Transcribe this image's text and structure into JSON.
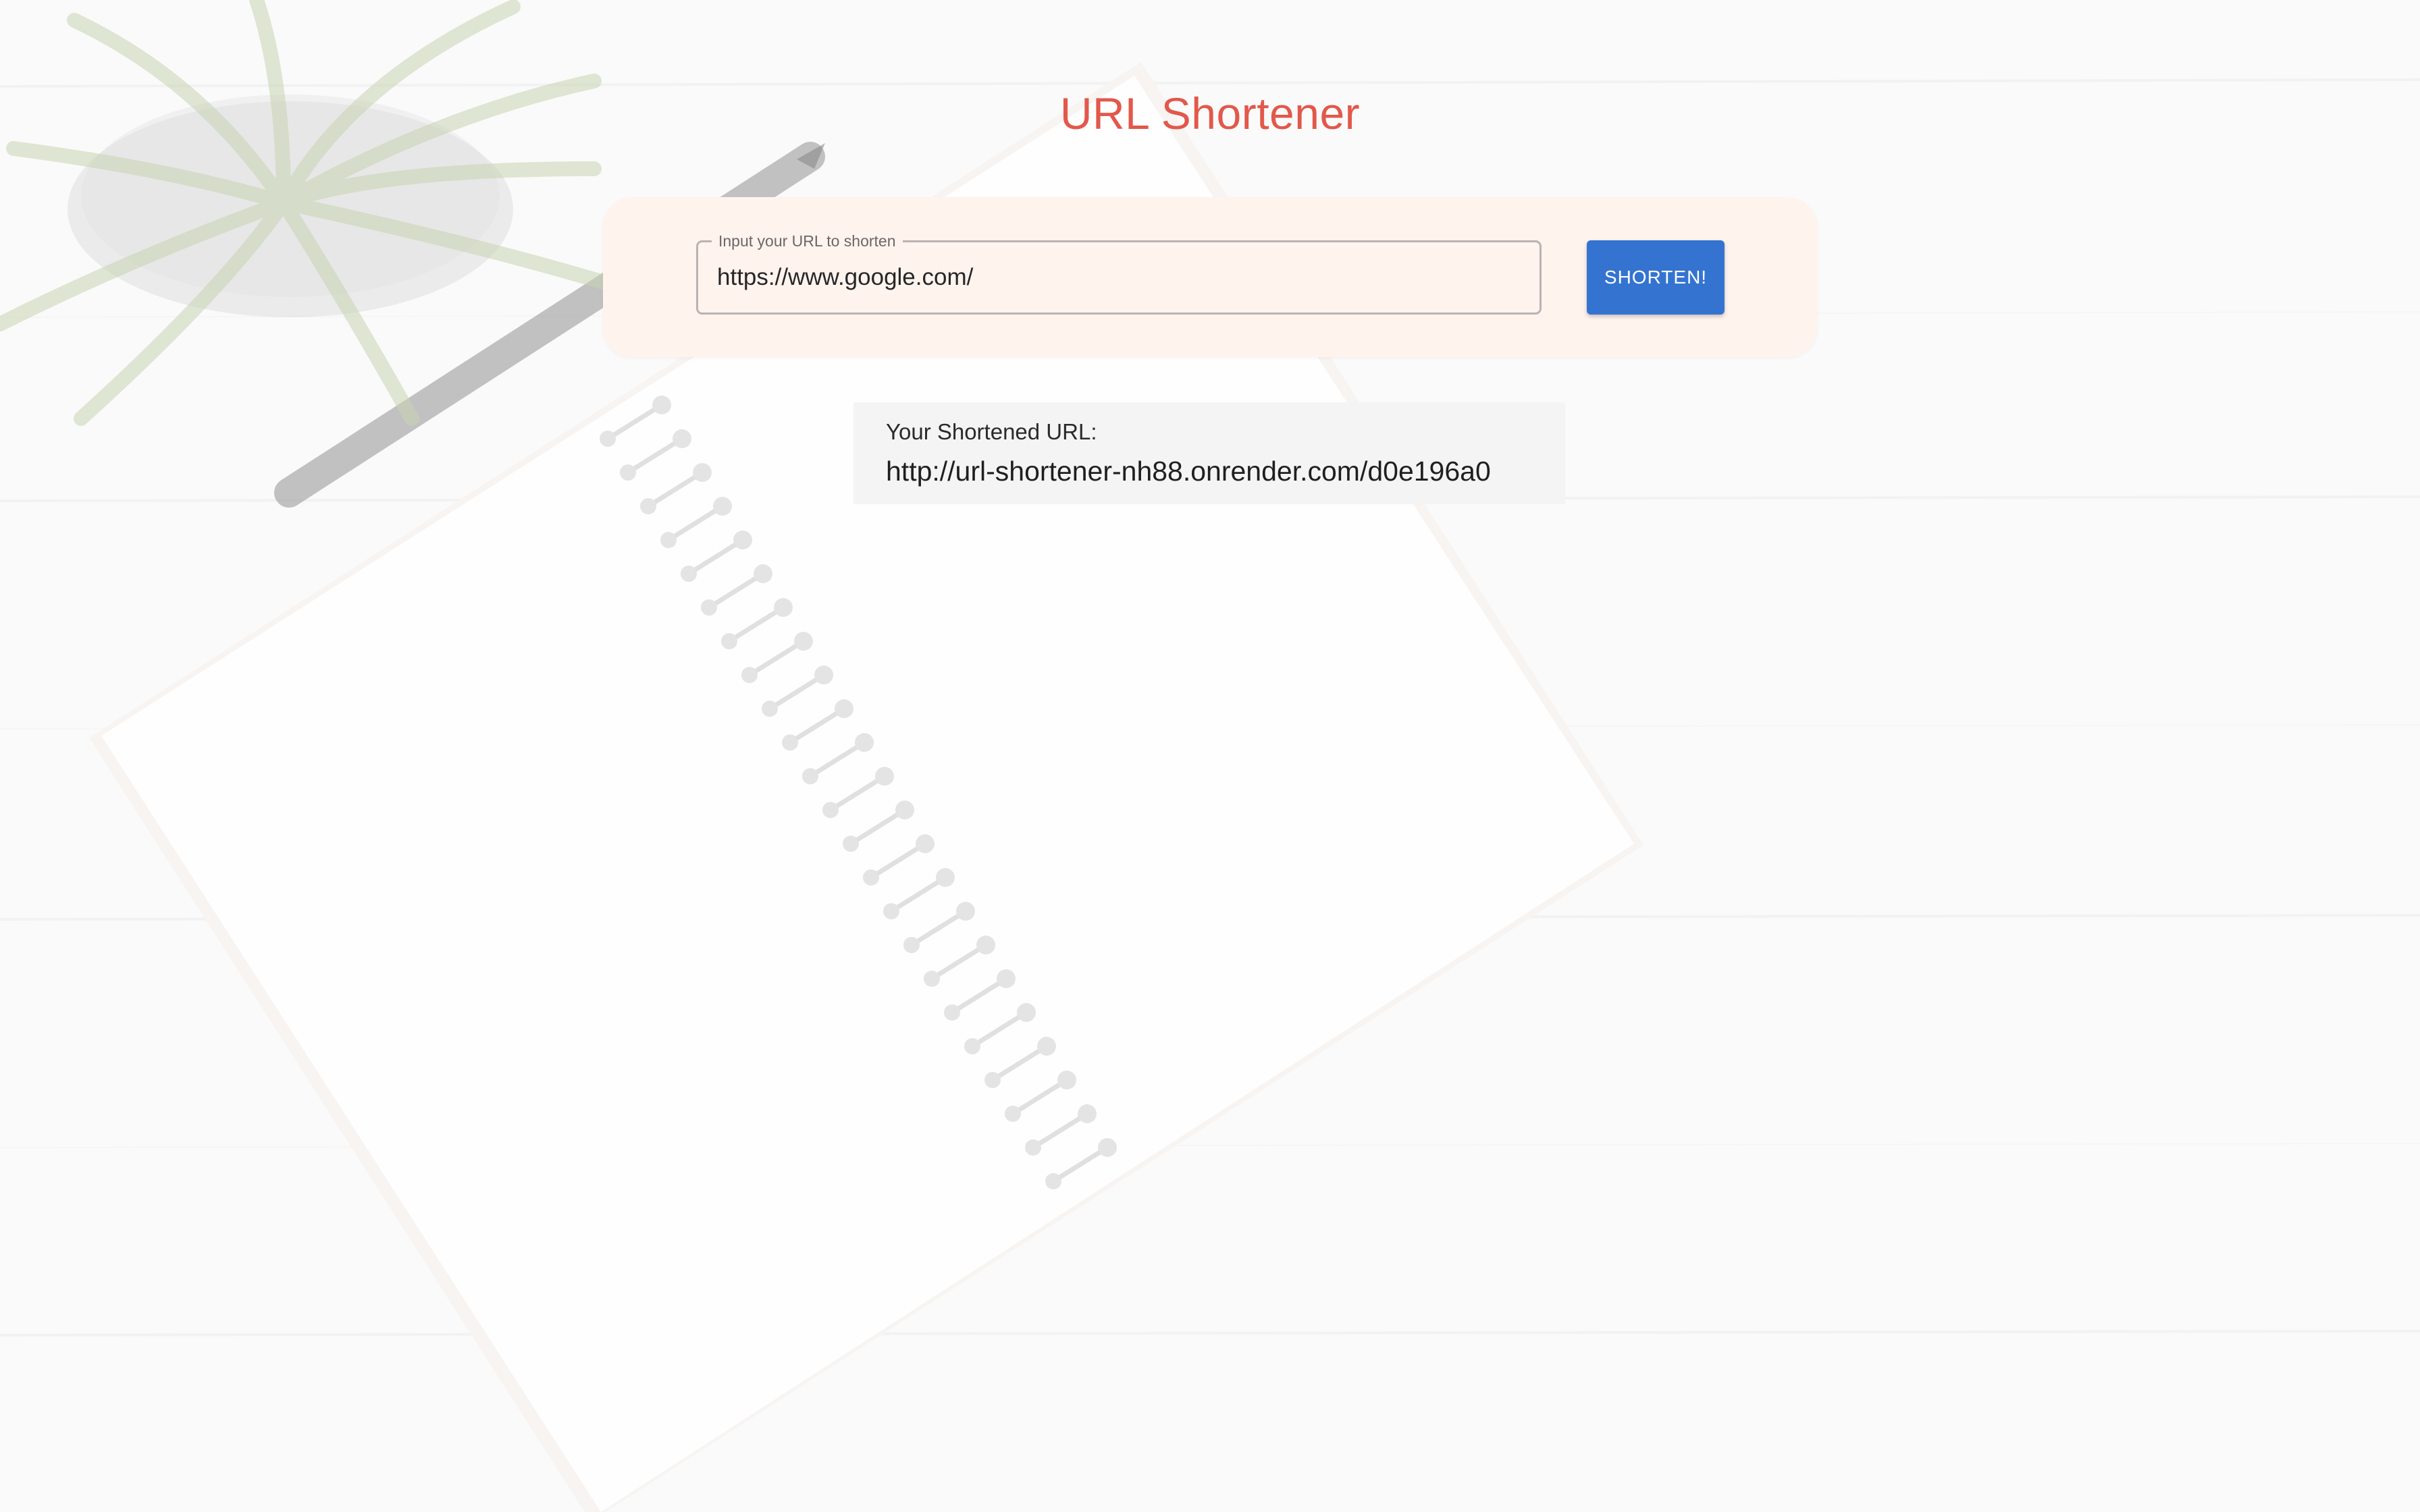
{
  "app": {
    "title": "URL Shortener"
  },
  "form": {
    "input_label": "Input your URL to shorten",
    "input_value": "https://www.google.com/",
    "submit_label": "SHORTEN!"
  },
  "result": {
    "label": "Your Shortened URL:",
    "url": "http://url-shortener-nh88.onrender.com/d0e196a0"
  },
  "colors": {
    "title": "#e2584b",
    "button": "#3474d0",
    "form_card_bg": "#fff3ee",
    "result_card_bg": "#f4f4f4"
  },
  "icons": {
    "background": "notebook-plant-desk-image"
  }
}
